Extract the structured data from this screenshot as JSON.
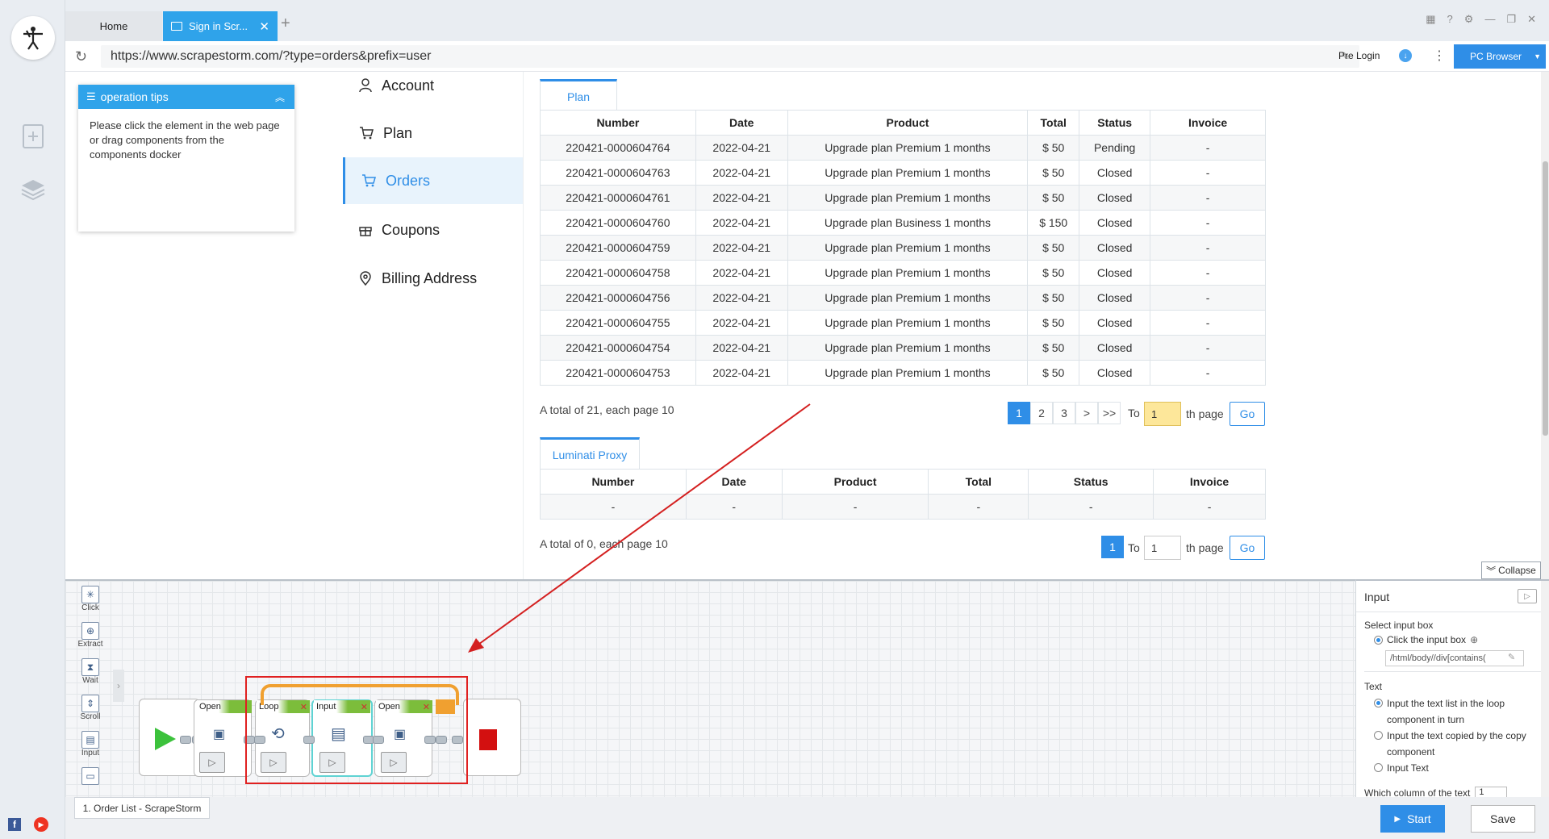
{
  "browser": {
    "tabs": [
      {
        "label": "Home"
      },
      {
        "label": "Sign in Scr..."
      }
    ],
    "url": "https://www.scrapestorm.com/?type=orders&prefix=user",
    "pre_login": "Pre Login",
    "pc_browser": "PC Browser"
  },
  "tips": {
    "title": "operation tips",
    "body": "Please click the element in the web page or drag components from the components docker"
  },
  "nav": {
    "items": [
      {
        "label": "Account",
        "icon": "user-icon"
      },
      {
        "label": "Plan",
        "icon": "cart-icon"
      },
      {
        "label": "Orders",
        "icon": "cart-icon",
        "active": true
      },
      {
        "label": "Coupons",
        "icon": "gift-icon"
      },
      {
        "label": "Billing Address",
        "icon": "location-icon"
      }
    ]
  },
  "plan_section": {
    "tab": "Plan",
    "headers": [
      "Number",
      "Date",
      "Product",
      "Total",
      "Status",
      "Invoice"
    ],
    "rows": [
      [
        "220421-0000604764",
        "2022-04-21",
        "Upgrade plan Premium 1 months",
        "$ 50",
        "Pending",
        "-"
      ],
      [
        "220421-0000604763",
        "2022-04-21",
        "Upgrade plan Premium 1 months",
        "$ 50",
        "Closed",
        "-"
      ],
      [
        "220421-0000604761",
        "2022-04-21",
        "Upgrade plan Premium 1 months",
        "$ 50",
        "Closed",
        "-"
      ],
      [
        "220421-0000604760",
        "2022-04-21",
        "Upgrade plan Business 1 months",
        "$ 150",
        "Closed",
        "-"
      ],
      [
        "220421-0000604759",
        "2022-04-21",
        "Upgrade plan Premium 1 months",
        "$ 50",
        "Closed",
        "-"
      ],
      [
        "220421-0000604758",
        "2022-04-21",
        "Upgrade plan Premium 1 months",
        "$ 50",
        "Closed",
        "-"
      ],
      [
        "220421-0000604756",
        "2022-04-21",
        "Upgrade plan Premium 1 months",
        "$ 50",
        "Closed",
        "-"
      ],
      [
        "220421-0000604755",
        "2022-04-21",
        "Upgrade plan Premium 1 months",
        "$ 50",
        "Closed",
        "-"
      ],
      [
        "220421-0000604754",
        "2022-04-21",
        "Upgrade plan Premium 1 months",
        "$ 50",
        "Closed",
        "-"
      ],
      [
        "220421-0000604753",
        "2022-04-21",
        "Upgrade plan Premium 1 months",
        "$ 50",
        "Closed",
        "-"
      ]
    ],
    "summary": "A total of 21, each page 10",
    "pages": [
      "1",
      "2",
      "3",
      ">",
      ">>"
    ],
    "to_label": "To",
    "page_value": "1",
    "th_page": "th page",
    "go": "Go"
  },
  "proxy_section": {
    "tab": "Luminati Proxy",
    "headers": [
      "Number",
      "Date",
      "Product",
      "Total",
      "Status",
      "Invoice"
    ],
    "rows": [
      [
        "-",
        "-",
        "-",
        "-",
        "-",
        "-"
      ]
    ],
    "summary": "A total of 0, each page 10",
    "pages": [
      "1"
    ],
    "to_label": "To",
    "page_value": "1",
    "th_page": "th page",
    "go": "Go"
  },
  "workflow": {
    "collapse": "Collapse",
    "components": [
      "Click",
      "Extract",
      "Wait",
      "Scroll",
      "Input"
    ],
    "blocks": {
      "open1": "Open",
      "loop": "Loop",
      "input": "Input",
      "open2": "Open"
    }
  },
  "right_panel": {
    "title": "Input",
    "select_label": "Select input box",
    "click_option": "Click the input box",
    "xpath": "/html/body//div[contains(",
    "text_label": "Text",
    "options": [
      "Input the text list in the loop component in turn",
      "Input the text copied by the copy component",
      "Input Text"
    ],
    "column_label": "Which column of the text",
    "column_value": "1"
  },
  "footer": {
    "task_tab": "1. Order List - ScrapeStorm",
    "start": "Start",
    "save": "Save"
  },
  "colors": {
    "accent": "#2f8ee7",
    "tab_active": "#2fa3ea",
    "highlight_box": "#e02020",
    "arrow": "#d42020"
  }
}
